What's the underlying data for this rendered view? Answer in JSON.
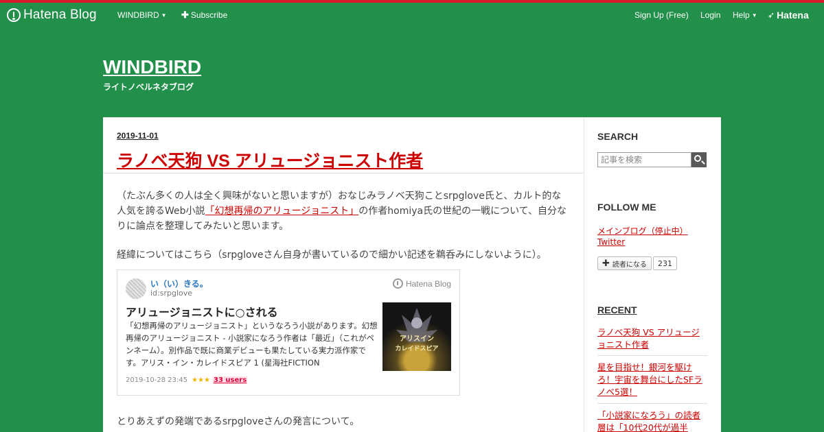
{
  "colors": {
    "background": "#22904a",
    "accent_red": "#c00",
    "top_stripe": "#d7192c"
  },
  "navbar": {
    "logo": "Hatena Blog",
    "blog_menu": "WINDBIRD",
    "subscribe": "Subscribe",
    "signup": "Sign Up (Free)",
    "login": "Login",
    "help": "Help",
    "hatena": "Hatena"
  },
  "blog": {
    "title": "WINDBIRD",
    "description": "ライトノベルネタブログ"
  },
  "post": {
    "date": "2019-11-01",
    "title": "ラノベ天狗 VS アリュージョニスト作者",
    "para1_before": "（たぶん多くの人は全く興味がないと思いますが）おなじみラノベ天狗ことsrpglove氏と、カルト的な人気を誇るWeb小説",
    "para1_link": "「幻想再帰のアリュージョニスト」",
    "para1_after": "の作者homiya氏の世紀の一戦について、自分なりに論点を整理してみたいと思います。",
    "para2": "経緯についてはこちら（srpgloveさん自身が書いているので細かい記述を鵜呑みにしないように）。",
    "para3": "とりあえずの発端であるsrpgloveさんの発言について。"
  },
  "card": {
    "author": "い（い）きる。",
    "author_id": "id:srpglove",
    "brand": "Hatena Blog",
    "title": "アリュージョニストに○される",
    "excerpt": "「幻想再帰のアリュージョニスト」というなろう小説があります。幻想再帰のアリュージョニスト - 小説家になろう作者は「最近」（これがペンネーム）。別作品で既に商業デビューも果たしている実力派作家です。アリス・イン・カレイドスピア 1 (星海社FICTION",
    "timestamp": "2019-10-28 23:45",
    "stars": "★★★",
    "users": "33 users",
    "thumb_text_1": "アリスイン",
    "thumb_text_2": "カレイドスピア"
  },
  "sidebar": {
    "search_heading": "SEARCH",
    "search_placeholder": "記事を検索",
    "follow_heading": "FOLLOW ME",
    "follow_link_1": "メインブログ（停止中）",
    "follow_link_2": "Twitter",
    "reader_button": "読者になる",
    "reader_count": "231",
    "recent_heading": "RECENT",
    "recent": [
      "ラノベ天狗 VS アリュージョニスト作者",
      "星を目指せ！銀河を駆けろ！宇宙を舞台にしたSFラノベ5選！",
      "「小説家になろう」の読者層は「10代20代が過半"
    ]
  }
}
